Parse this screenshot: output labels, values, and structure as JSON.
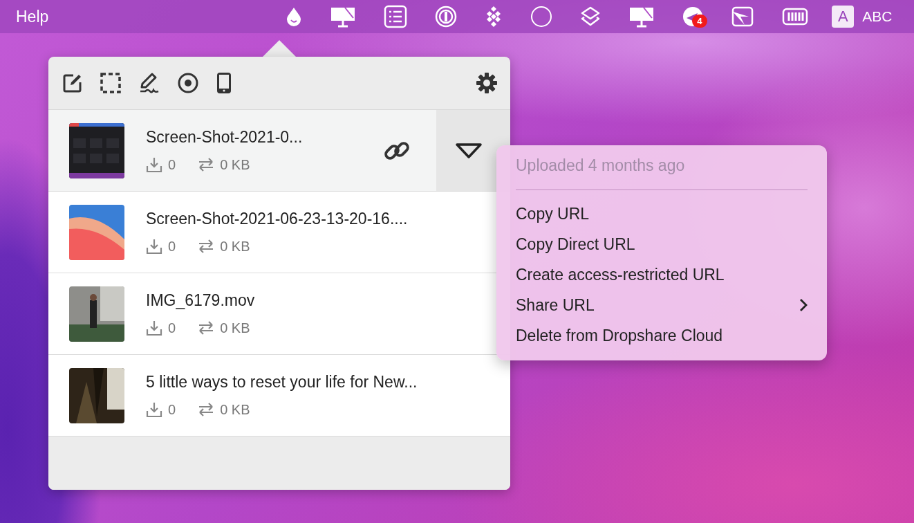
{
  "menu_bar": {
    "title": "Help",
    "badge": "4",
    "input_letter": "A",
    "input_label": "ABC"
  },
  "files": [
    {
      "name": "Screen-Shot-2021-0...",
      "downloads": "0",
      "size": "0 KB",
      "selected": true
    },
    {
      "name": "Screen-Shot-2021-06-23-13-20-16....",
      "downloads": "0",
      "size": "0 KB",
      "selected": false
    },
    {
      "name": "IMG_6179.mov",
      "downloads": "0",
      "size": "0 KB",
      "selected": false
    },
    {
      "name": "5 little ways to reset your life for New...",
      "downloads": "0",
      "size": "0 KB",
      "selected": false
    }
  ],
  "context_menu": {
    "header": "Uploaded 4 months ago",
    "items": [
      {
        "label": "Copy URL",
        "submenu": false
      },
      {
        "label": "Copy Direct URL",
        "submenu": false
      },
      {
        "label": "Create access-restricted URL",
        "submenu": false
      },
      {
        "label": "Share URL",
        "submenu": true
      },
      {
        "label": "Delete from Dropshare Cloud",
        "submenu": false
      }
    ]
  }
}
